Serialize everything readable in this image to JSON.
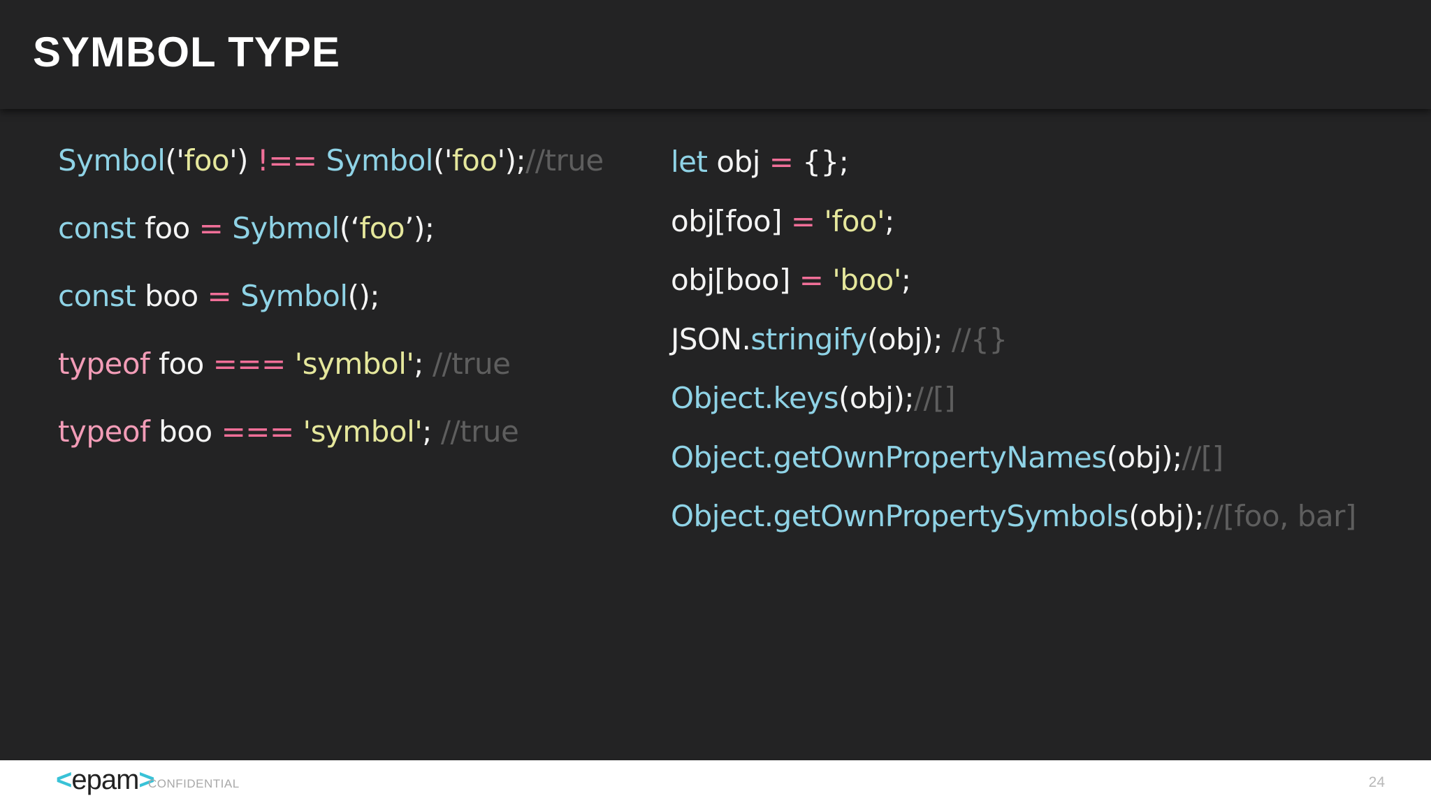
{
  "slide": {
    "title": "SYMBOL TYPE",
    "page_number": "24"
  },
  "footer": {
    "logo_open": "<",
    "logo_text": "epam",
    "logo_close": ">",
    "confidential": "CONFIDENTIAL"
  },
  "colors": {
    "background": "#232324",
    "function": "#8fd3e6",
    "keyword_typeof": "#f29cb7",
    "operator": "#f06f98",
    "string": "#e5e79c",
    "comment": "#5e5e5e",
    "plain": "#f4f4f4",
    "logo_accent": "#39c2d7"
  },
  "left_code": [
    [
      {
        "t": "Symbol",
        "c": "fn"
      },
      {
        "t": "('",
        "c": "plain"
      },
      {
        "t": "foo",
        "c": "str"
      },
      {
        "t": "') ",
        "c": "plain"
      },
      {
        "t": "!==",
        "c": "op"
      },
      {
        "t": " ",
        "c": "plain"
      },
      {
        "t": "Symbol",
        "c": "fn"
      },
      {
        "t": "('",
        "c": "plain"
      },
      {
        "t": "foo",
        "c": "str"
      },
      {
        "t": "');",
        "c": "plain"
      },
      {
        "t": "//true",
        "c": "cmt"
      }
    ],
    [
      {
        "t": "const",
        "c": "kw"
      },
      {
        "t": " foo ",
        "c": "plain"
      },
      {
        "t": "=",
        "c": "op"
      },
      {
        "t": " ",
        "c": "plain"
      },
      {
        "t": "Sybmol",
        "c": "fn"
      },
      {
        "t": "(‘",
        "c": "plain"
      },
      {
        "t": "foo",
        "c": "str"
      },
      {
        "t": "’);",
        "c": "plain"
      }
    ],
    [
      {
        "t": "const",
        "c": "kw"
      },
      {
        "t": " boo ",
        "c": "plain"
      },
      {
        "t": "=",
        "c": "op"
      },
      {
        "t": " ",
        "c": "plain"
      },
      {
        "t": "Symbol",
        "c": "fn"
      },
      {
        "t": "();",
        "c": "plain"
      }
    ],
    [
      {
        "t": "typeof",
        "c": "typeof"
      },
      {
        "t": " foo ",
        "c": "plain"
      },
      {
        "t": "===",
        "c": "op"
      },
      {
        "t": " '",
        "c": "str"
      },
      {
        "t": "symbol",
        "c": "str"
      },
      {
        "t": "'",
        "c": "str"
      },
      {
        "t": "; ",
        "c": "plain"
      },
      {
        "t": "//true",
        "c": "cmt"
      }
    ],
    [
      {
        "t": "typeof",
        "c": "typeof"
      },
      {
        "t": " boo ",
        "c": "plain"
      },
      {
        "t": "===",
        "c": "op"
      },
      {
        "t": " '",
        "c": "str"
      },
      {
        "t": "symbol",
        "c": "str"
      },
      {
        "t": "'",
        "c": "str"
      },
      {
        "t": "; ",
        "c": "plain"
      },
      {
        "t": "//true",
        "c": "cmt"
      }
    ]
  ],
  "right_code": [
    [
      {
        "t": "let",
        "c": "kw"
      },
      {
        "t": " obj ",
        "c": "plain"
      },
      {
        "t": "=",
        "c": "op"
      },
      {
        "t": " {};",
        "c": "plain"
      }
    ],
    [
      {
        "t": "obj[foo] ",
        "c": "plain"
      },
      {
        "t": "=",
        "c": "op"
      },
      {
        "t": " ",
        "c": "plain"
      },
      {
        "t": "'foo'",
        "c": "str"
      },
      {
        "t": ";",
        "c": "plain"
      }
    ],
    [
      {
        "t": "obj[boo] ",
        "c": "plain"
      },
      {
        "t": "=",
        "c": "op"
      },
      {
        "t": " ",
        "c": "plain"
      },
      {
        "t": "'boo'",
        "c": "str"
      },
      {
        "t": ";",
        "c": "plain"
      }
    ],
    [
      {
        "t": "JSON.",
        "c": "plain"
      },
      {
        "t": "stringify",
        "c": "fn"
      },
      {
        "t": "(obj); ",
        "c": "plain"
      },
      {
        "t": "//{}",
        "c": "cmt"
      }
    ],
    [
      {
        "t": "Object.keys",
        "c": "fn"
      },
      {
        "t": "(obj);",
        "c": "plain"
      },
      {
        "t": "//[]",
        "c": "cmt"
      }
    ],
    [
      {
        "t": "Object.getOwnPropertyNames",
        "c": "fn"
      },
      {
        "t": "(obj);",
        "c": "plain"
      },
      {
        "t": "//[]",
        "c": "cmt"
      }
    ],
    [
      {
        "t": "Object.getOwnPropertySymbols",
        "c": "fn"
      },
      {
        "t": "(obj);",
        "c": "plain"
      },
      {
        "t": "//[foo, bar]",
        "c": "cmt"
      }
    ]
  ]
}
